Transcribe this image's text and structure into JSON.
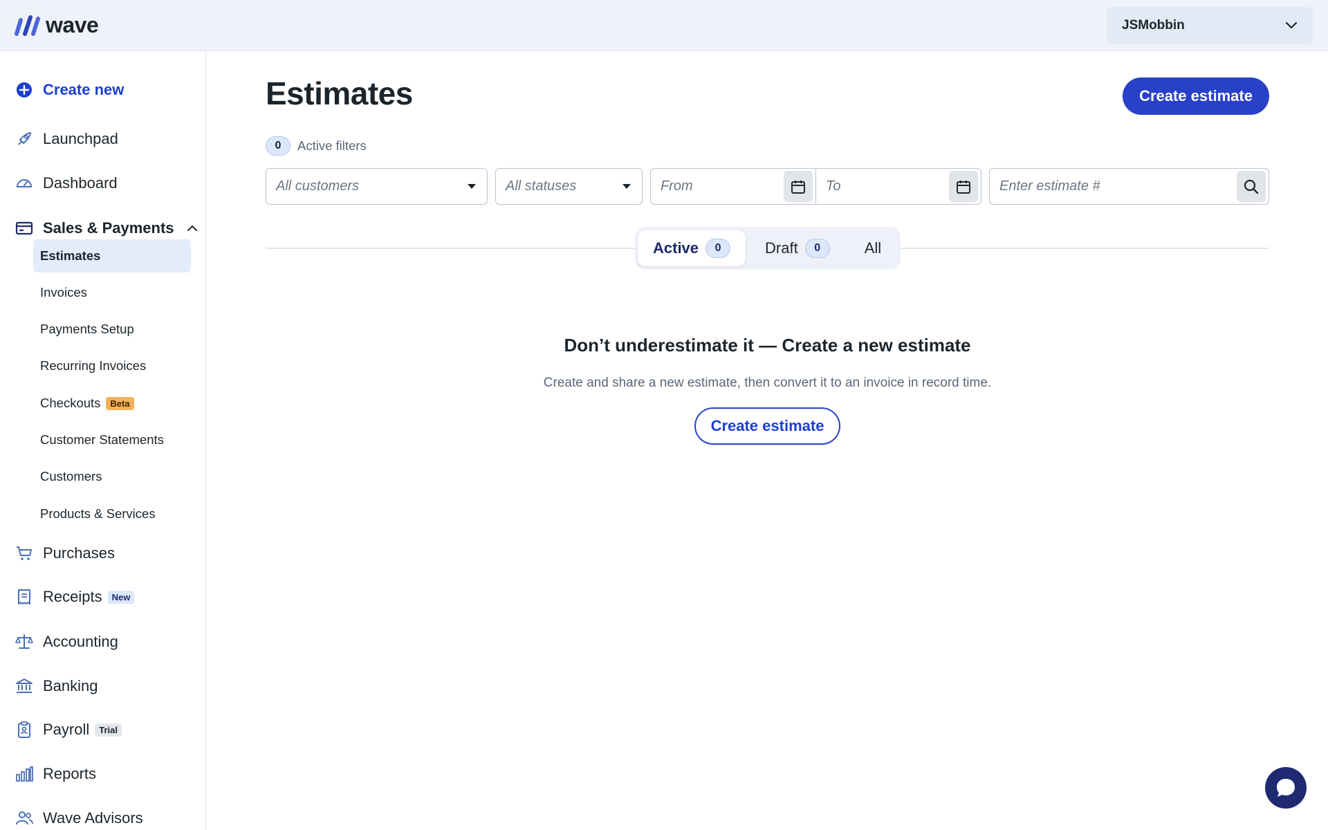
{
  "brand": {
    "name": "wave",
    "accent": "#2940c9",
    "logo_icon": "wave-logo-icon"
  },
  "account": {
    "name": "JSMobbin"
  },
  "sidebar": {
    "create_new": "Create new",
    "launchpad": "Launchpad",
    "dashboard": "Dashboard",
    "sales_payments": "Sales & Payments",
    "sub": {
      "estimates": "Estimates",
      "invoices": "Invoices",
      "payments_setup": "Payments Setup",
      "recurring_invoices": "Recurring Invoices",
      "checkouts": "Checkouts",
      "checkouts_badge": "Beta",
      "customer_statements": "Customer Statements",
      "customers": "Customers",
      "products_services": "Products & Services"
    },
    "purchases": "Purchases",
    "receipts": "Receipts",
    "receipts_badge": "New",
    "accounting": "Accounting",
    "banking": "Banking",
    "payroll": "Payroll",
    "payroll_badge": "Trial",
    "reports": "Reports",
    "wave_advisors": "Wave Advisors"
  },
  "main": {
    "title": "Estimates",
    "create_button": "Create estimate",
    "active_filters_count": "0",
    "active_filters_label": "Active filters",
    "filters": {
      "customers_placeholder": "All customers",
      "statuses_placeholder": "All statuses",
      "from_placeholder": "From",
      "to_placeholder": "To",
      "estimate_number_placeholder": "Enter estimate #"
    },
    "tabs": [
      {
        "label": "Active",
        "count": "0"
      },
      {
        "label": "Draft",
        "count": "0"
      },
      {
        "label": "All"
      }
    ],
    "empty_state": {
      "title": "Don’t underestimate it — Create a new estimate",
      "description": "Create and share a new estimate, then convert it to an invoice in record time.",
      "button": "Create estimate"
    }
  }
}
